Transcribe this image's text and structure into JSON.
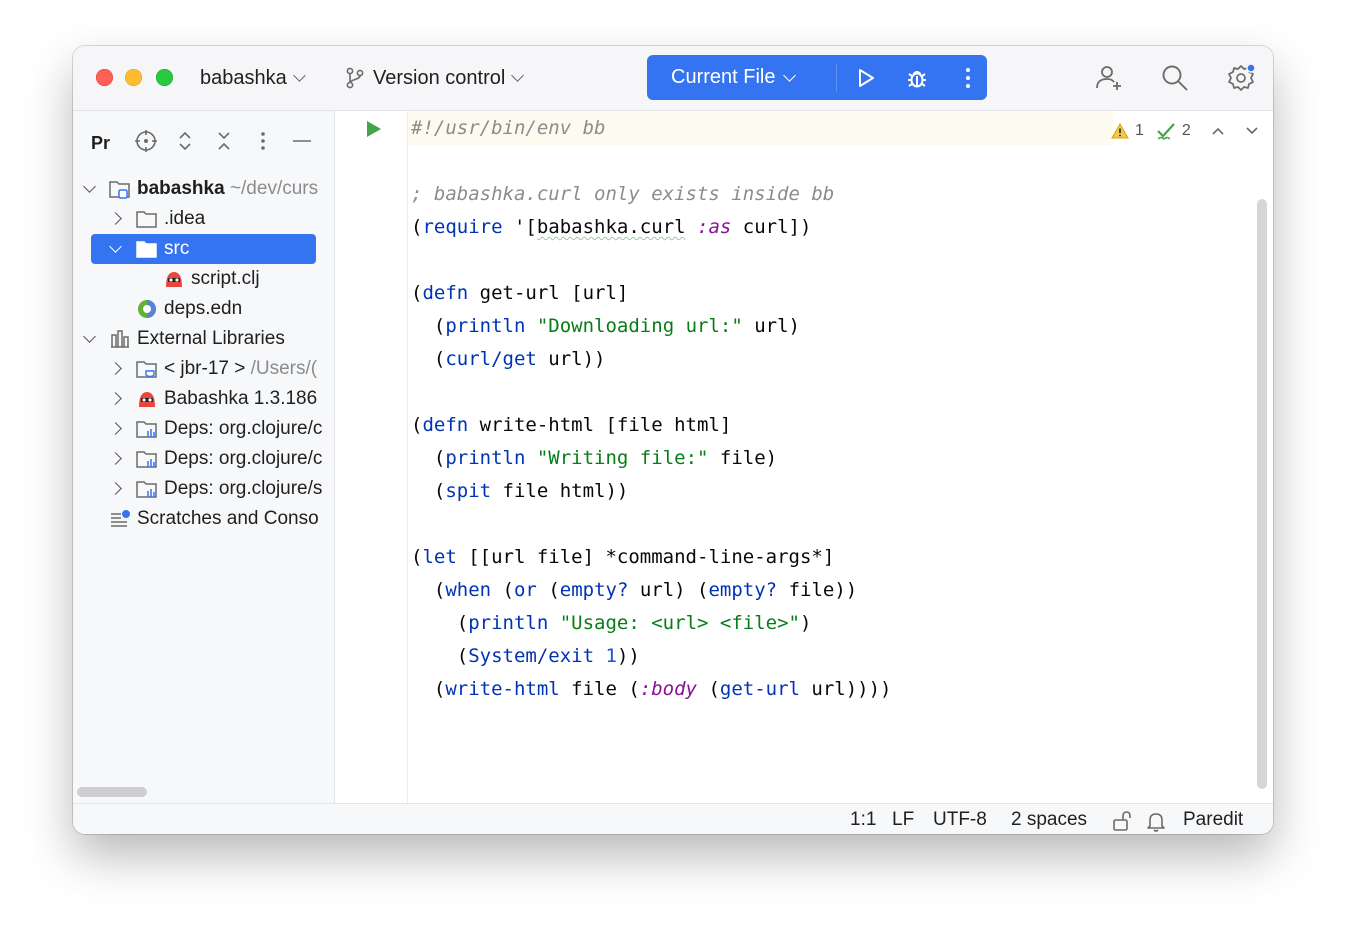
{
  "titlebar": {
    "project_name": "babashka",
    "vcs_label": "Version control",
    "run_config": "Current File",
    "icons": [
      "run-icon",
      "debug-icon",
      "more-icon",
      "account-icon",
      "search-icon",
      "settings-icon"
    ],
    "accent": "#3574f0"
  },
  "project_panel": {
    "title": "Pr",
    "toolbar_icons": [
      "locate-icon",
      "expand-icon",
      "collapse-icon",
      "options-icon",
      "hide-icon"
    ],
    "tree": [
      {
        "label": "babashka",
        "hint": "~/dev/curs",
        "expanded": true
      },
      {
        "label": ".idea"
      },
      {
        "label": "src",
        "selected": true,
        "expanded": true
      },
      {
        "label": "script.clj"
      },
      {
        "label": "deps.edn"
      },
      {
        "label": "External Libraries",
        "expanded": true
      },
      {
        "label": "< jbr-17 >",
        "hint": "/Users/("
      },
      {
        "label": "Babashka 1.3.186"
      },
      {
        "label": "Deps: org.clojure/c"
      },
      {
        "label": "Deps: org.clojure/c"
      },
      {
        "label": "Deps: org.clojure/s"
      },
      {
        "label": "Scratches and Conso"
      }
    ]
  },
  "editor": {
    "warnings": "1",
    "weak_warnings": "2",
    "lines": [
      {
        "text": "#!/usr/bin/env bb"
      },
      {
        "text": ""
      },
      {
        "text": "; babashka.curl only exists inside bb"
      },
      {
        "parts": [
          "(",
          "require",
          " '[",
          "babashka.curl",
          " ",
          ":as",
          " curl])"
        ]
      },
      {
        "text": ""
      },
      {
        "parts": [
          "(",
          "defn",
          " get-url [url]"
        ]
      },
      {
        "parts": [
          "  (",
          "println",
          " ",
          "\"Downloading url:\"",
          " url)"
        ]
      },
      {
        "parts": [
          "  (",
          "curl/get",
          " url))"
        ]
      },
      {
        "text": ""
      },
      {
        "parts": [
          "(",
          "defn",
          " write-html [file html]"
        ]
      },
      {
        "parts": [
          "  (",
          "println",
          " ",
          "\"Writing file:\"",
          " file)"
        ]
      },
      {
        "parts": [
          "  (",
          "spit",
          " file html))"
        ]
      },
      {
        "text": ""
      },
      {
        "parts": [
          "(",
          "let",
          " [[url file] *command-line-args*]"
        ]
      },
      {
        "parts": [
          "  (",
          "when",
          " (",
          "or",
          " (",
          "empty?",
          " url) (",
          "empty?",
          " file))"
        ]
      },
      {
        "parts": [
          "    (",
          "println",
          " ",
          "\"Usage: <url> <file>\"",
          ")"
        ]
      },
      {
        "parts": [
          "    (",
          "System/exit",
          " ",
          "1",
          "))"
        ]
      },
      {
        "parts": [
          "  (",
          "write-html",
          " file (",
          ":body",
          " (",
          "get-url",
          " url))))"
        ]
      }
    ]
  },
  "statusbar": {
    "position": "1:1",
    "line_separator": "LF",
    "encoding": "UTF-8",
    "indent": "2 spaces",
    "mode": "Paredit"
  }
}
